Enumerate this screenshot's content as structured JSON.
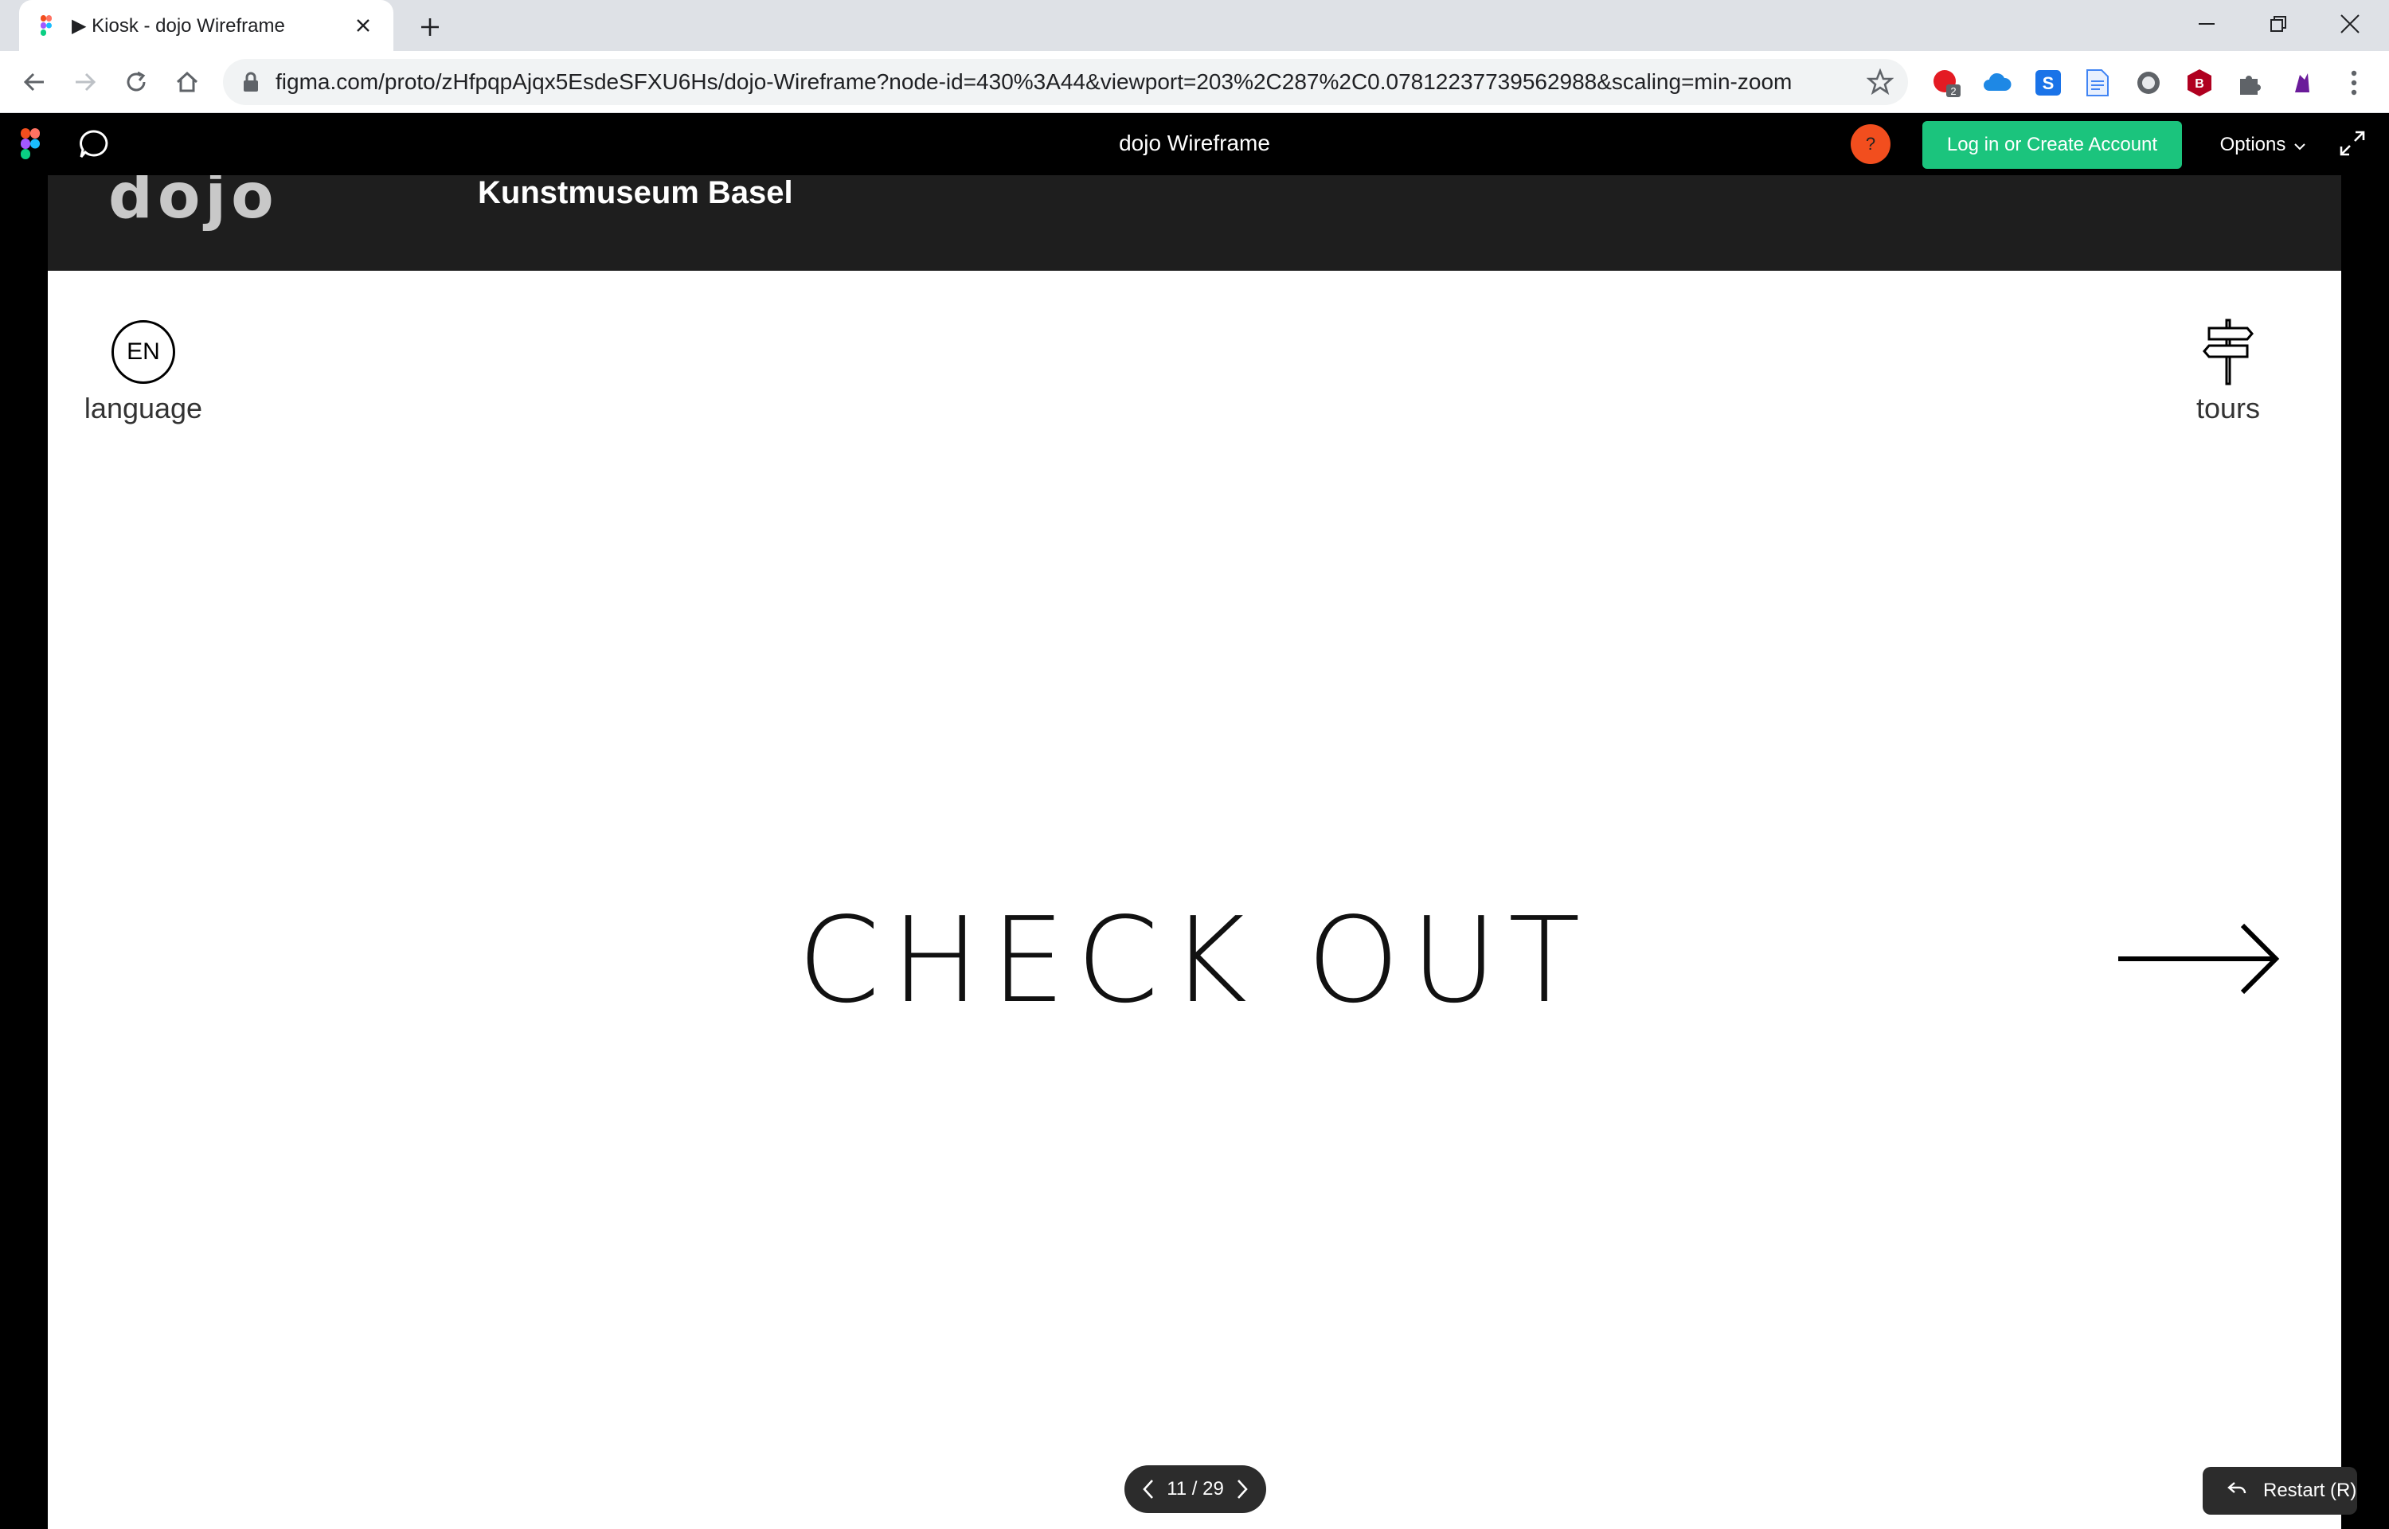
{
  "browser": {
    "tab_title": "▶ Kiosk - dojo Wireframe",
    "url": "figma.com/proto/zHfpqpAjqx5EsdeSFXU6Hs/dojo-Wireframe?node-id=430%3A44&viewport=203%2C287%2C0.07812237739562988&scaling=min-zoom",
    "extension_badge": "2"
  },
  "figma": {
    "file_title": "dojo Wireframe",
    "help_label": "?",
    "login_label": "Log in or Create Account",
    "options_label": "Options",
    "page_indicator": "11 / 29",
    "restart_label": "Restart (R)"
  },
  "kiosk": {
    "logo_text": "dojo",
    "venue": "Kunstmuseum Basel",
    "language_code": "EN",
    "language_label": "language",
    "tours_label": "tours",
    "headline": "CHECK OUT"
  },
  "colors": {
    "figma_accent": "#1bc47d",
    "help_badge": "#f24e1e"
  }
}
